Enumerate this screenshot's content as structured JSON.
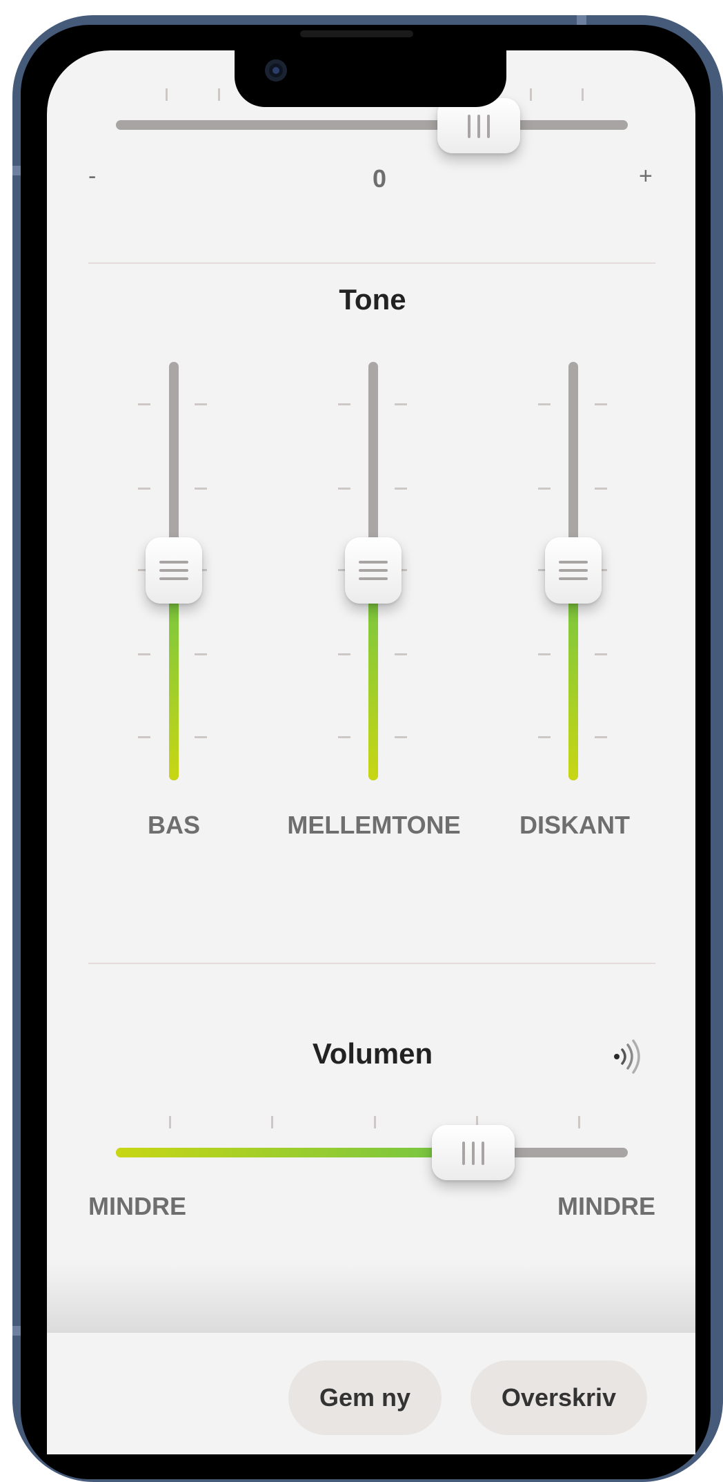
{
  "colors": {
    "track": "#a8a4a4",
    "fill_start": "#c8d614",
    "fill_end": "#6fc446",
    "background": "#f3f3f3",
    "button_bg": "#e9e5e3"
  },
  "top_slider": {
    "min_label": "-",
    "value_label": "0",
    "max_label": "+",
    "value_fraction": 0.63
  },
  "tone": {
    "title": "Tone",
    "sliders": [
      {
        "label": "BAS",
        "value_fraction": 0.5
      },
      {
        "label": "MELLEMTONE",
        "value_fraction": 0.5
      },
      {
        "label": "DISKANT",
        "value_fraction": 0.5
      }
    ]
  },
  "volume": {
    "title": "Volumen",
    "icon": "sound-waves-icon",
    "min_label": "MINDRE",
    "max_label": "MINDRE",
    "value_fraction": 0.63
  },
  "buttons": {
    "save_new": "Gem ny",
    "overwrite": "Overskriv"
  }
}
